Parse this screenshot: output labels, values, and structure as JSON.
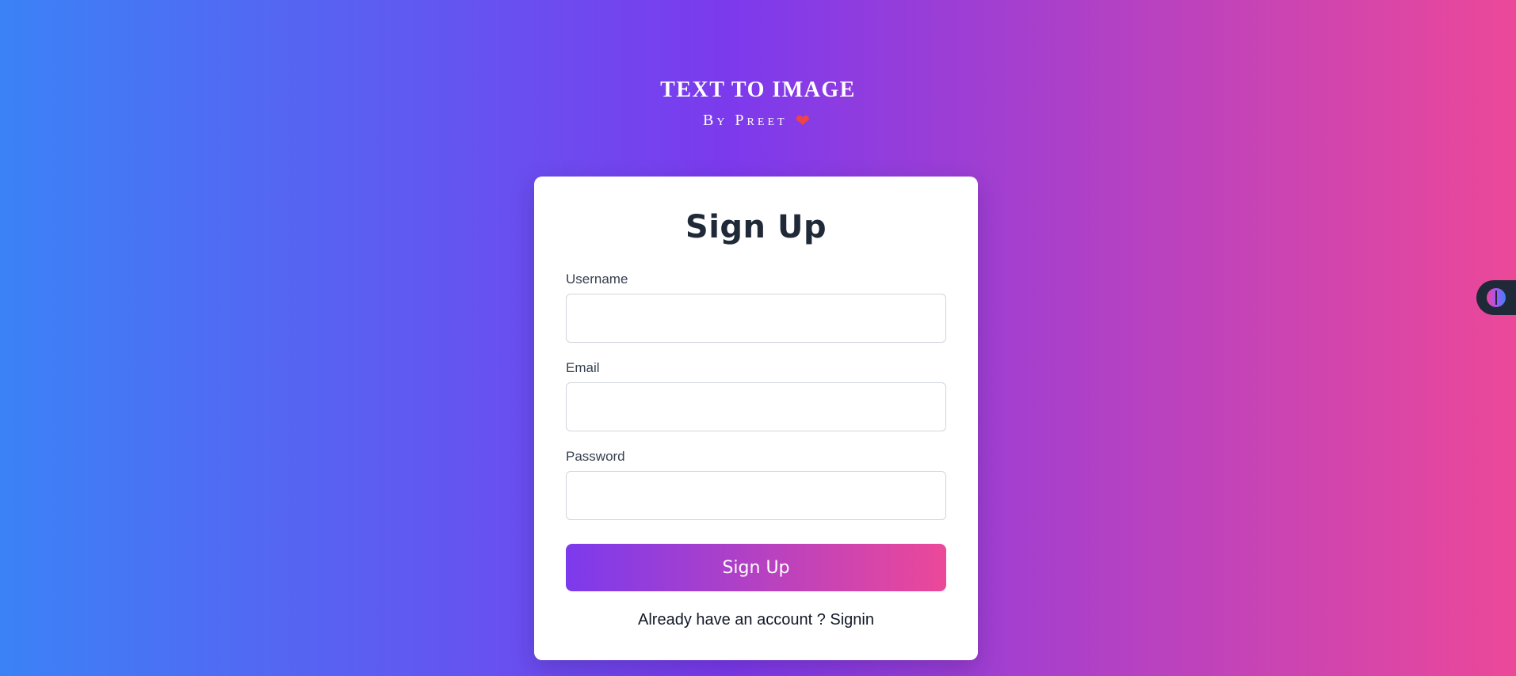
{
  "header": {
    "title": "TEXT TO IMAGE",
    "byline": "By Preet",
    "heart_icon": "❤"
  },
  "form": {
    "title": "Sign Up",
    "fields": [
      {
        "label": "Username",
        "value": "",
        "placeholder": ""
      },
      {
        "label": "Email",
        "value": "",
        "placeholder": ""
      },
      {
        "label": "Password",
        "value": "",
        "placeholder": ""
      }
    ],
    "submit_label": "Sign Up",
    "signin_prompt": "Already have an account ?",
    "signin_link": "Signin"
  },
  "side_widget": {
    "icon": "brain-icon"
  },
  "colors": {
    "gradient_start": "#3b82f6",
    "gradient_mid": "#7c3aed",
    "gradient_end": "#ec4899",
    "button_start": "#7c3aed",
    "button_end": "#ec4899"
  }
}
